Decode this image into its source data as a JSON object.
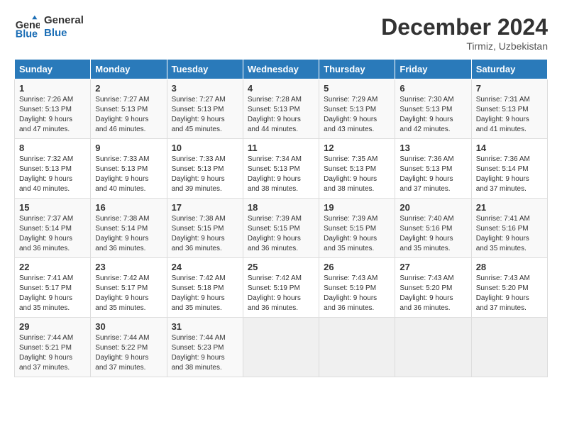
{
  "logo": {
    "line1": "General",
    "line2": "Blue"
  },
  "title": "December 2024",
  "location": "Tirmiz, Uzbekistan",
  "days_of_week": [
    "Sunday",
    "Monday",
    "Tuesday",
    "Wednesday",
    "Thursday",
    "Friday",
    "Saturday"
  ],
  "weeks": [
    [
      {
        "day": "1",
        "sunrise": "7:26 AM",
        "sunset": "5:13 PM",
        "daylight": "9 hours and 47 minutes."
      },
      {
        "day": "2",
        "sunrise": "7:27 AM",
        "sunset": "5:13 PM",
        "daylight": "9 hours and 46 minutes."
      },
      {
        "day": "3",
        "sunrise": "7:27 AM",
        "sunset": "5:13 PM",
        "daylight": "9 hours and 45 minutes."
      },
      {
        "day": "4",
        "sunrise": "7:28 AM",
        "sunset": "5:13 PM",
        "daylight": "9 hours and 44 minutes."
      },
      {
        "day": "5",
        "sunrise": "7:29 AM",
        "sunset": "5:13 PM",
        "daylight": "9 hours and 43 minutes."
      },
      {
        "day": "6",
        "sunrise": "7:30 AM",
        "sunset": "5:13 PM",
        "daylight": "9 hours and 42 minutes."
      },
      {
        "day": "7",
        "sunrise": "7:31 AM",
        "sunset": "5:13 PM",
        "daylight": "9 hours and 41 minutes."
      }
    ],
    [
      {
        "day": "8",
        "sunrise": "7:32 AM",
        "sunset": "5:13 PM",
        "daylight": "9 hours and 40 minutes."
      },
      {
        "day": "9",
        "sunrise": "7:33 AM",
        "sunset": "5:13 PM",
        "daylight": "9 hours and 40 minutes."
      },
      {
        "day": "10",
        "sunrise": "7:33 AM",
        "sunset": "5:13 PM",
        "daylight": "9 hours and 39 minutes."
      },
      {
        "day": "11",
        "sunrise": "7:34 AM",
        "sunset": "5:13 PM",
        "daylight": "9 hours and 38 minutes."
      },
      {
        "day": "12",
        "sunrise": "7:35 AM",
        "sunset": "5:13 PM",
        "daylight": "9 hours and 38 minutes."
      },
      {
        "day": "13",
        "sunrise": "7:36 AM",
        "sunset": "5:13 PM",
        "daylight": "9 hours and 37 minutes."
      },
      {
        "day": "14",
        "sunrise": "7:36 AM",
        "sunset": "5:14 PM",
        "daylight": "9 hours and 37 minutes."
      }
    ],
    [
      {
        "day": "15",
        "sunrise": "7:37 AM",
        "sunset": "5:14 PM",
        "daylight": "9 hours and 36 minutes."
      },
      {
        "day": "16",
        "sunrise": "7:38 AM",
        "sunset": "5:14 PM",
        "daylight": "9 hours and 36 minutes."
      },
      {
        "day": "17",
        "sunrise": "7:38 AM",
        "sunset": "5:15 PM",
        "daylight": "9 hours and 36 minutes."
      },
      {
        "day": "18",
        "sunrise": "7:39 AM",
        "sunset": "5:15 PM",
        "daylight": "9 hours and 36 minutes."
      },
      {
        "day": "19",
        "sunrise": "7:39 AM",
        "sunset": "5:15 PM",
        "daylight": "9 hours and 35 minutes."
      },
      {
        "day": "20",
        "sunrise": "7:40 AM",
        "sunset": "5:16 PM",
        "daylight": "9 hours and 35 minutes."
      },
      {
        "day": "21",
        "sunrise": "7:41 AM",
        "sunset": "5:16 PM",
        "daylight": "9 hours and 35 minutes."
      }
    ],
    [
      {
        "day": "22",
        "sunrise": "7:41 AM",
        "sunset": "5:17 PM",
        "daylight": "9 hours and 35 minutes."
      },
      {
        "day": "23",
        "sunrise": "7:42 AM",
        "sunset": "5:17 PM",
        "daylight": "9 hours and 35 minutes."
      },
      {
        "day": "24",
        "sunrise": "7:42 AM",
        "sunset": "5:18 PM",
        "daylight": "9 hours and 35 minutes."
      },
      {
        "day": "25",
        "sunrise": "7:42 AM",
        "sunset": "5:19 PM",
        "daylight": "9 hours and 36 minutes."
      },
      {
        "day": "26",
        "sunrise": "7:43 AM",
        "sunset": "5:19 PM",
        "daylight": "9 hours and 36 minutes."
      },
      {
        "day": "27",
        "sunrise": "7:43 AM",
        "sunset": "5:20 PM",
        "daylight": "9 hours and 36 minutes."
      },
      {
        "day": "28",
        "sunrise": "7:43 AM",
        "sunset": "5:20 PM",
        "daylight": "9 hours and 37 minutes."
      }
    ],
    [
      {
        "day": "29",
        "sunrise": "7:44 AM",
        "sunset": "5:21 PM",
        "daylight": "9 hours and 37 minutes."
      },
      {
        "day": "30",
        "sunrise": "7:44 AM",
        "sunset": "5:22 PM",
        "daylight": "9 hours and 37 minutes."
      },
      {
        "day": "31",
        "sunrise": "7:44 AM",
        "sunset": "5:23 PM",
        "daylight": "9 hours and 38 minutes."
      },
      null,
      null,
      null,
      null
    ]
  ]
}
